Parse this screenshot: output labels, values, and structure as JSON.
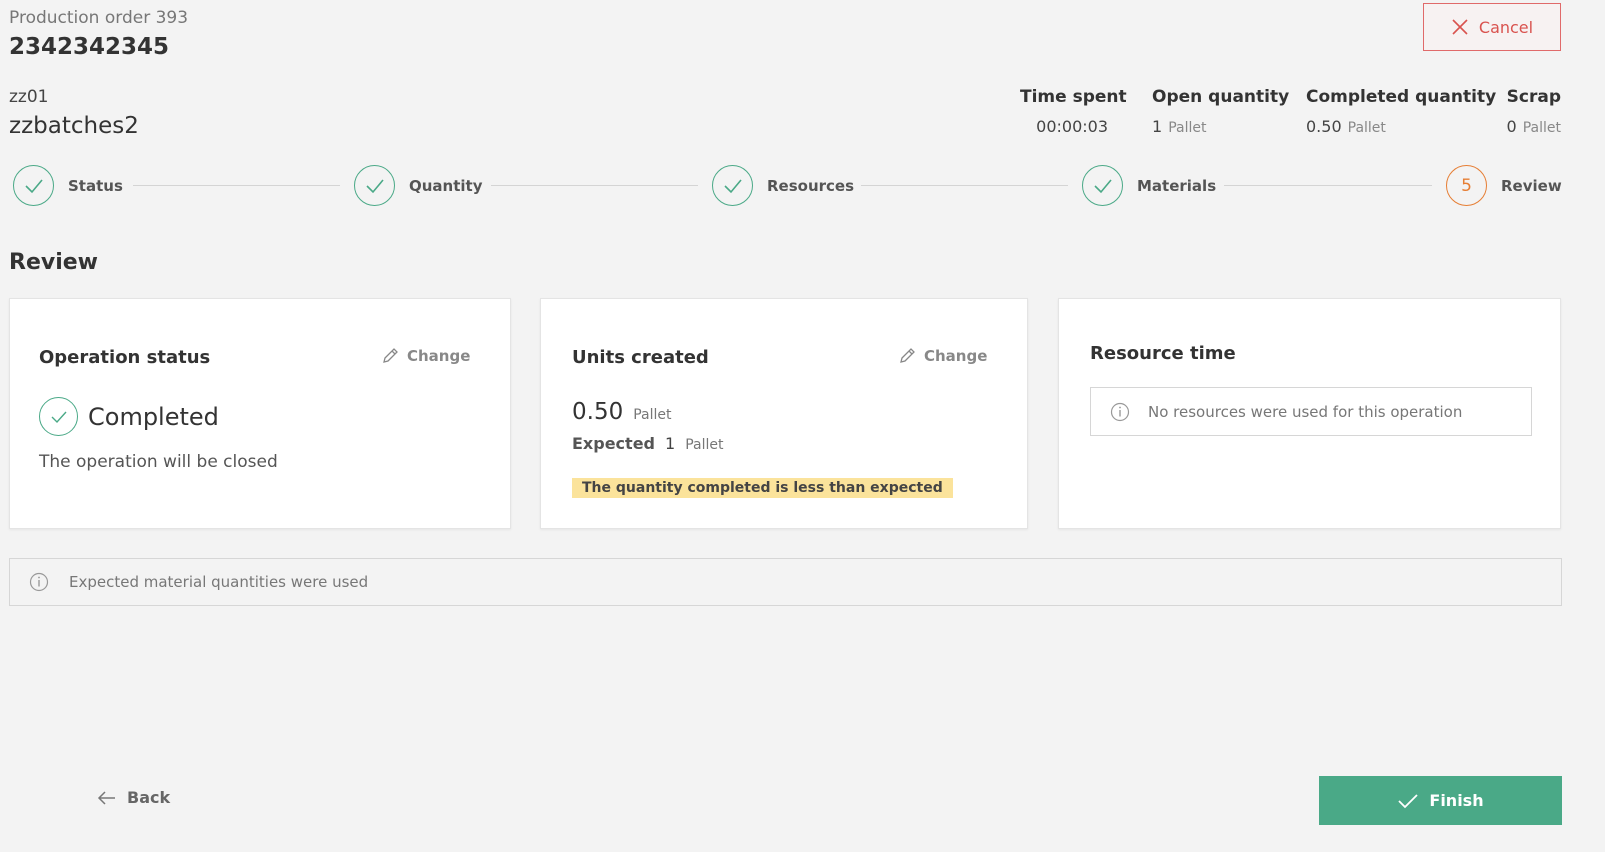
{
  "header": {
    "order_label": "Production order 393",
    "order_number": "2342342345",
    "cancel_label": "Cancel",
    "operation_code": "zz01",
    "operation_name": "zzbatches2"
  },
  "metrics": [
    {
      "label": "Time spent",
      "value": "00:00:03",
      "unit": ""
    },
    {
      "label": "Open quantity",
      "value": "1",
      "unit": "Pallet"
    },
    {
      "label": "Completed quantity",
      "value": "0.50",
      "unit": "Pallet"
    },
    {
      "label": "Scrap",
      "value": "0",
      "unit": "Pallet"
    }
  ],
  "steps": [
    {
      "label": "Status",
      "state": "done"
    },
    {
      "label": "Quantity",
      "state": "done"
    },
    {
      "label": "Resources",
      "state": "done"
    },
    {
      "label": "Materials",
      "state": "done"
    },
    {
      "label": "Review",
      "state": "active",
      "number": "5"
    }
  ],
  "review": {
    "title": "Review",
    "operation_status": {
      "title": "Operation status",
      "change_label": "Change",
      "status": "Completed",
      "note": "The operation will be closed"
    },
    "units_created": {
      "title": "Units created",
      "change_label": "Change",
      "value": "0.50",
      "unit": "Pallet",
      "expected_label": "Expected",
      "expected_value": "1",
      "expected_unit": "Pallet",
      "warning": "The quantity completed is less than expected"
    },
    "resource_time": {
      "title": "Resource time",
      "info": "No resources were used for this operation"
    },
    "materials_info": "Expected material quantities were used"
  },
  "footer": {
    "back_label": "Back",
    "finish_label": "Finish"
  },
  "colors": {
    "accent": "#4aa987",
    "active_step": "#e67e34",
    "cancel": "#d9534f",
    "warning_bg": "#fbe39b"
  }
}
